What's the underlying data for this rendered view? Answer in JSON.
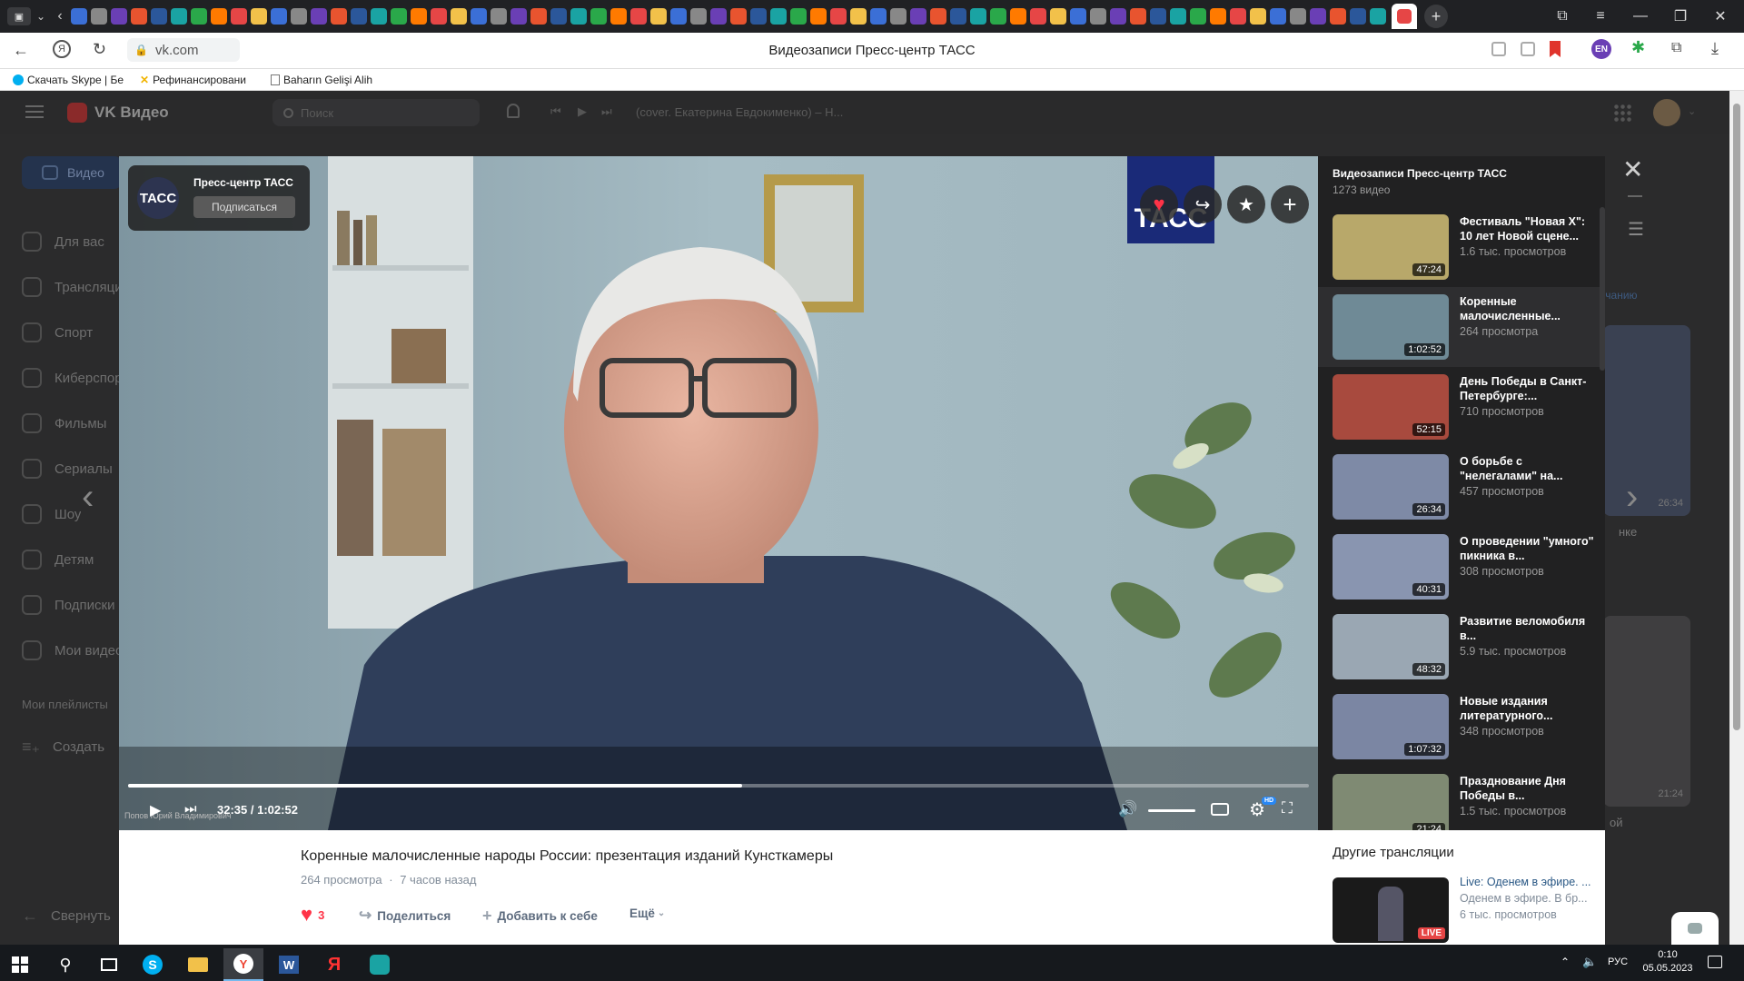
{
  "browser": {
    "url": "vk.com",
    "page_title": "Видеозаписи Пресс-центр ТАСС",
    "lang_badge": "EN",
    "bookmarks": [
      "Скачать Skype | Бе",
      "Рефинансировани",
      "Baharın Gelişi Alih"
    ]
  },
  "vk_header": {
    "logo_text": "VK Видео",
    "search_placeholder": "Поиск",
    "now_playing": "(cover. Екатерина Евдокименко) – Н..."
  },
  "sidebar": {
    "active_tab": "Видео",
    "items": [
      "Для вас",
      "Трансляции",
      "Спорт",
      "Киберспорт",
      "Фильмы",
      "Сериалы",
      "Шоу",
      "Детям",
      "Подписки",
      "Мои видео"
    ],
    "playlists_label": "Мои плейлисты",
    "create_label": "Создать",
    "collapse_label": "Свернуть"
  },
  "player": {
    "channel_name": "Пресс-центр ТАСС",
    "channel_avatar_text": "ТАСС",
    "subscribe_label": "Подписаться",
    "watermark": "ТАСС",
    "speaker_caption": "Попов Юрий Владимирович",
    "time_current": "32:35",
    "time_sep": "/",
    "time_total": "1:02:52",
    "progress": 0.52,
    "volume": 1.0,
    "hd_badge": "HD"
  },
  "playlist": {
    "title": "Видеозаписи Пресс-центр ТАСС",
    "count": "1273 видео",
    "items": [
      {
        "title": "Фестиваль \"Новая Х\": 10 лет Новой сцене...",
        "views": "1.6 тыс. просмотров",
        "duration": "47:24",
        "color": "#b8a86a"
      },
      {
        "title": "Коренные малочисленные...",
        "views": "264 просмотра",
        "duration": "1:02:52",
        "color": "#6f8a96"
      },
      {
        "title": "День Победы в Санкт-Петербурге:...",
        "views": "710 просмотров",
        "duration": "52:15",
        "color": "#a84a3e"
      },
      {
        "title": "О борьбе с \"нелегалами\" на...",
        "views": "457 просмотров",
        "duration": "26:34",
        "color": "#7e8aa6"
      },
      {
        "title": "О проведении \"умного\" пикника в...",
        "views": "308 просмотров",
        "duration": "40:31",
        "color": "#8995b0"
      },
      {
        "title": "Развитие веломобиля в...",
        "views": "5.9 тыс. просмотров",
        "duration": "48:32",
        "color": "#9aa7b3"
      },
      {
        "title": "Новые издания литературного...",
        "views": "348 просмотров",
        "duration": "1:07:32",
        "color": "#7b86a3"
      },
      {
        "title": "Празднование Дня Победы в...",
        "views": "1.5 тыс. просмотров",
        "duration": "21:24",
        "color": "#7f8a73"
      }
    ]
  },
  "video_info": {
    "title": "Коренные малочисленные народы России: презентация изданий Кунсткамеры",
    "views": "264 просмотра",
    "dot": "·",
    "time_ago": "7 часов назад",
    "likes": "3",
    "share_label": "Поделиться",
    "add_label": "Добавить к себе",
    "more_label": "Ещё"
  },
  "other_streams": {
    "heading": "Другие трансляции",
    "title": "Live: Оденем в эфире. ...",
    "subtitle": "Оденем в эфире. В бр...",
    "views": "6 тыс. просмотров",
    "live_badge": "LIVE"
  },
  "background_right": {
    "sort_label": "умолчанию",
    "thumb1_dur": "26:34",
    "thumb2_dur": "21:24",
    "label1": "нке",
    "label2": "ой"
  },
  "taskbar": {
    "lang": "РУС",
    "time": "0:10",
    "date": "05.05.2023"
  }
}
